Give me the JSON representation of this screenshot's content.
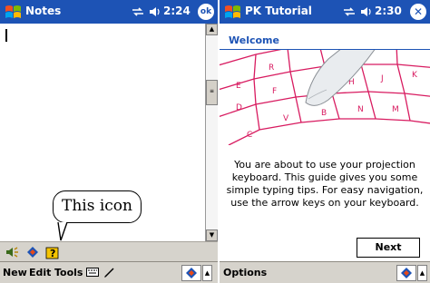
{
  "left": {
    "title": "Notes",
    "time": "2:24",
    "ok_label": "ok",
    "callout_text": "This icon",
    "menu": [
      "New",
      "Edit",
      "Tools"
    ]
  },
  "right": {
    "title": "PK Tutorial",
    "time": "2:30",
    "close_glyph": "✕",
    "heading": "Welcome",
    "body": "You are about to use your projection keyboard. This guide gives you some simple typing tips. For easy navigation, use the arrow keys on your keyboard.",
    "next_label": "Next",
    "menu": [
      "Options"
    ]
  },
  "colors": {
    "titlebar": "#1d53b5",
    "heading": "#1d53b5",
    "keys": "#d81b60"
  }
}
